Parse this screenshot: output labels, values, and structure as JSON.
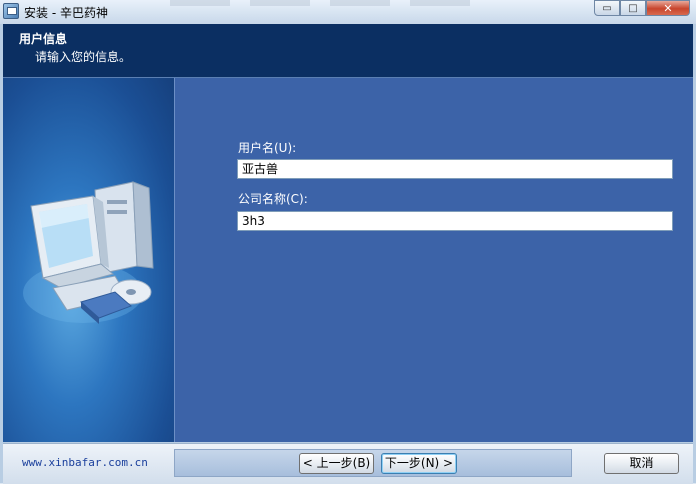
{
  "window": {
    "title": "安装 - 辛巴药神",
    "minimize_label": "▭",
    "restore_label": "□",
    "close_label": "✕"
  },
  "header": {
    "title": "用户信息",
    "subtitle": "请输入您的信息。"
  },
  "form": {
    "username_label": "用户名(U):",
    "username_value": "亚古兽",
    "company_label": "公司名称(C):",
    "company_value": "3h3"
  },
  "footer": {
    "website": "www.xinbafar.com.cn",
    "back_label": "< 上一步(B)",
    "next_label": "下一步(N) >",
    "cancel_label": "取消"
  },
  "colors": {
    "header_bg": "#0b2f62",
    "panel_bg": "#3c63a8",
    "link": "#1a3f9c"
  },
  "icons": {
    "app": "setup-icon",
    "art": "computer-with-cd-icon"
  }
}
